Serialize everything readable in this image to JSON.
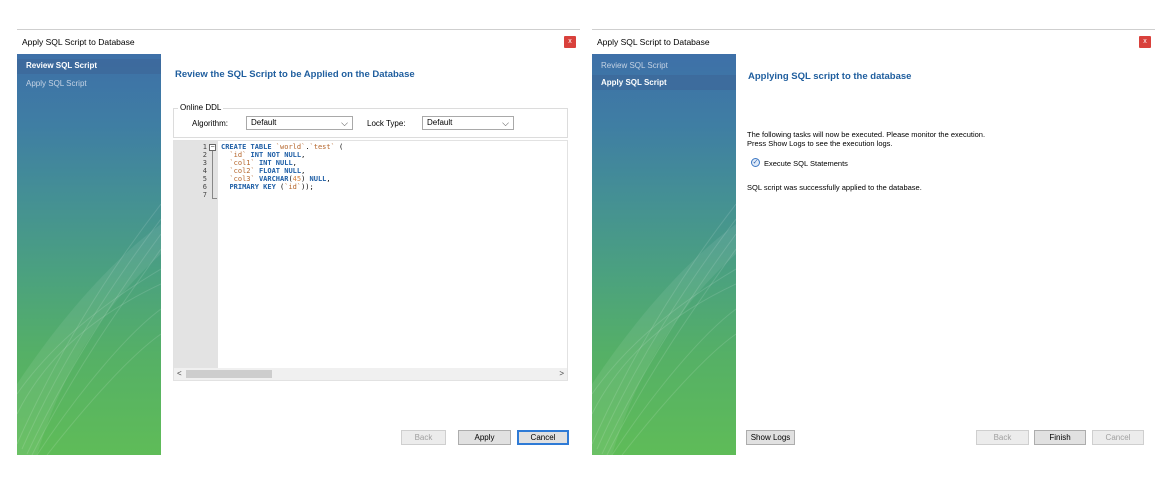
{
  "window1": {
    "title": "Apply SQL Script to Database",
    "close_label": "x",
    "sidebar": [
      {
        "label": "Review SQL Script"
      },
      {
        "label": "Apply SQL Script"
      }
    ],
    "page_title": "Review the SQL Script to be Applied on the Database",
    "online_ddl": {
      "legend": "Online DDL",
      "algorithm_label": "Algorithm:",
      "algorithm_value": "Default",
      "lock_type_label": "Lock Type:",
      "lock_type_value": "Default"
    },
    "editor": {
      "line_numbers": [
        "1",
        "2",
        "3",
        "4",
        "5",
        "6",
        "7"
      ]
    },
    "buttons": {
      "back": "Back",
      "apply": "Apply",
      "cancel": "Cancel"
    }
  },
  "window2": {
    "title": "Apply SQL Script to Database",
    "close_label": "x",
    "sidebar": [
      {
        "label": "Review SQL Script"
      },
      {
        "label": "Apply SQL Script"
      }
    ],
    "page_title": "Applying SQL script to the database",
    "description_line1": "The following tasks will now be executed. Please monitor the execution.",
    "description_line2": "Press Show Logs to see the execution logs.",
    "task_label": "Execute SQL Statements",
    "status_text": "SQL script was successfully applied to the database.",
    "buttons": {
      "show_logs": "Show Logs",
      "back": "Back",
      "finish": "Finish",
      "cancel": "Cancel"
    }
  },
  "icons": {
    "close": "close-icon",
    "chevron": "chevron-down-icon",
    "check": "check-icon",
    "fold": "fold-minus-icon"
  }
}
